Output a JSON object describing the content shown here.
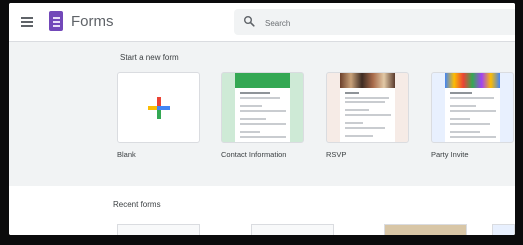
{
  "app": {
    "title": "Forms"
  },
  "search": {
    "placeholder": "Search",
    "value": ""
  },
  "start_section": {
    "title": "Start a new form",
    "templates": [
      {
        "label": "Blank"
      },
      {
        "label": "Contact Information"
      },
      {
        "label": "RSVP"
      },
      {
        "label": "Party Invite"
      }
    ]
  },
  "recent_section": {
    "title": "Recent forms"
  },
  "colors": {
    "forms_brand": "#7248b9",
    "contact_banner": "#34a853",
    "background": "#f1f3f4",
    "plus_blue": "#4285f4",
    "plus_red": "#ea4335",
    "plus_yellow": "#fbbc04",
    "plus_green": "#34a853"
  },
  "icons": [
    "menu-icon",
    "forms-logo-icon",
    "search-icon",
    "plus-icon"
  ]
}
